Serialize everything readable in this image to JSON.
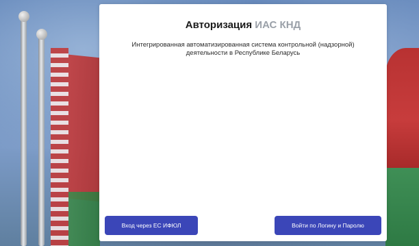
{
  "modal": {
    "title_main": "Авторизация",
    "title_accent": "ИАС КНД",
    "subtitle_line1": "Интегрированная автоматизированная система контрольной (надзорной)",
    "subtitle_line2": "деятельности в Республике Беларусь"
  },
  "buttons": {
    "login_es_ifiul": "Вход через ЕС ИФЮЛ",
    "login_password": "Войти по Логину и Паролю"
  },
  "colors": {
    "button_bg": "#3b46b8",
    "title_accent": "#9aa0a8"
  }
}
